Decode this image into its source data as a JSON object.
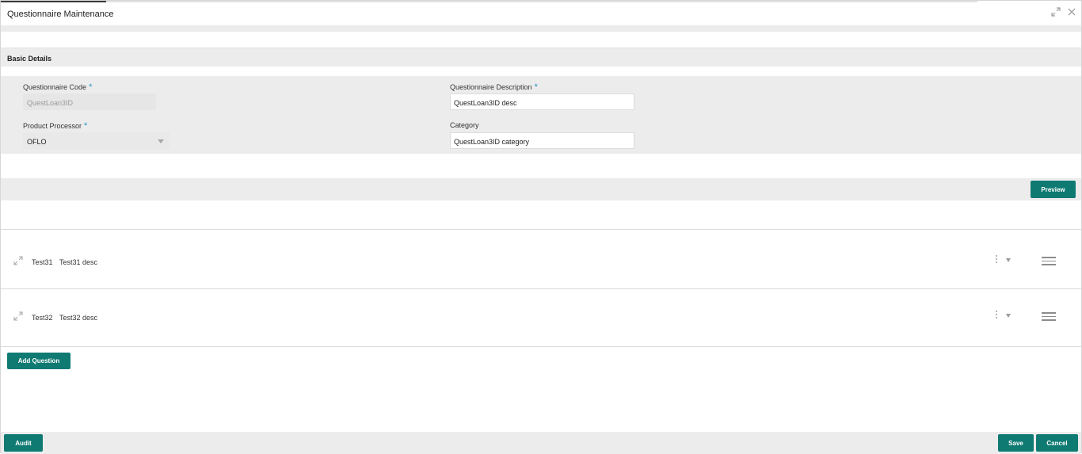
{
  "window": {
    "title": "Questionnaire Maintenance",
    "icons": [
      "maximize-icon",
      "close-icon"
    ]
  },
  "basic_details": {
    "section_label": "Basic Details",
    "questionnaire_code": {
      "label": "Questionnaire Code",
      "required_mark": "*",
      "value": "QuestLoan3ID",
      "disabled": true
    },
    "questionnaire_description": {
      "label": "Questionnaire Description",
      "required_mark": "*",
      "value": "QuestLoan3ID desc"
    },
    "product_processor": {
      "label": "Product Processor",
      "required_mark": "*",
      "value": "OFLO"
    },
    "category": {
      "label": "Category",
      "value": "QuestLoan3ID category"
    }
  },
  "toolbar": {
    "preview_label": "Preview",
    "add_question_label": "Add Question"
  },
  "questions": [
    {
      "code": "Test31",
      "description": "Test31 desc"
    },
    {
      "code": "Test32",
      "description": "Test32 desc"
    }
  ],
  "footer": {
    "audit_label": "Audit",
    "save_label": "Save",
    "cancel_label": "Cancel"
  },
  "colors": {
    "accent": "#0f7a72",
    "required": "#2a94c0",
    "band": "#ececec"
  }
}
